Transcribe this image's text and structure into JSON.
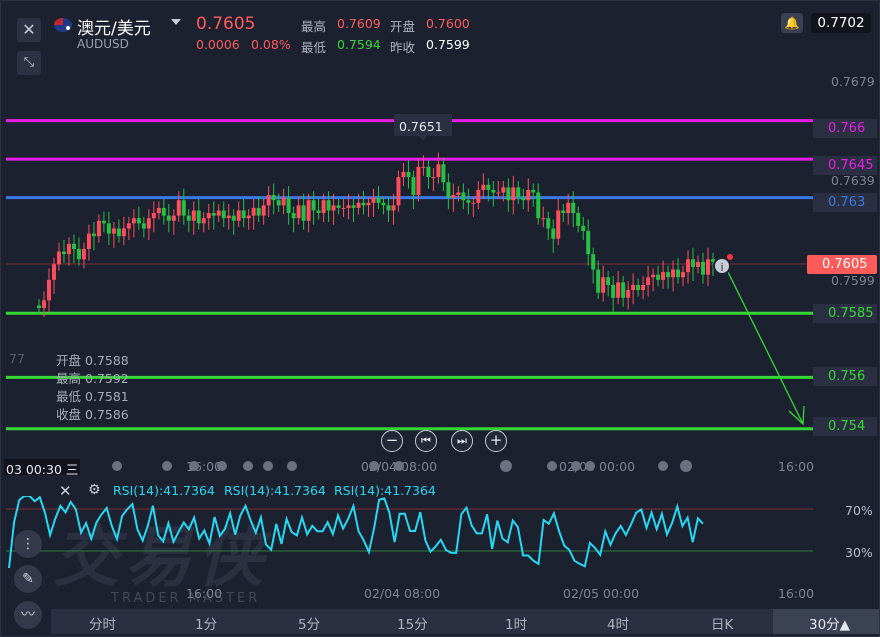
{
  "header": {
    "title": "澳元/美元",
    "code": "AUDUSD",
    "price": "0.7605",
    "change": "0.0006",
    "change_pct": "0.08%",
    "high_label": "最高",
    "high": "0.7609",
    "open_label": "开盘",
    "open": "0.7600",
    "low_label": "最低",
    "low": "0.7594",
    "prev_label": "昨收",
    "prev": "0.7599",
    "alert_price": "0.7702"
  },
  "icons": {
    "close": "close-icon",
    "collapse": "collapse-icon",
    "flag": "flag-icon",
    "bell": "bell-icon",
    "settings": "gear-icon",
    "crosshair": "crosshair-icon",
    "draw": "pencil-icon",
    "indicator": "chart-icon"
  },
  "levels": [
    {
      "label": "0.766",
      "value": 0.766,
      "color": "#e81ee8"
    },
    {
      "label": "0.7645",
      "value": 0.7645,
      "color": "#e81ee8"
    },
    {
      "label": "0.763",
      "value": 0.763,
      "color": "#3a78e8"
    },
    {
      "label": "0.7585",
      "value": 0.7585,
      "color": "#36d636"
    },
    {
      "label": "0.756",
      "value": 0.756,
      "color": "#36d636"
    },
    {
      "label": "0.754",
      "value": 0.754,
      "color": "#36d636"
    }
  ],
  "price_axis": [
    "0.7679",
    "0.7639",
    "0.7599"
  ],
  "current_tag": "0.7605",
  "peak_label": "0.7651",
  "ohlc_box": {
    "open_label": "开盘",
    "open": "0.7588",
    "high_label": "最高",
    "high": "0.7592",
    "low_label": "最低",
    "low": "0.7581",
    "close_label": "收盘",
    "close": "0.7586"
  },
  "time_axis": {
    "cursor": "03 00:30 三",
    "left_fragment": "77",
    "labels": [
      "16:00",
      "02/04 08:00",
      "02/05 00:00",
      "16:00"
    ]
  },
  "rsi": {
    "labels": [
      "RSI(14):41.7364",
      "RSI(14):41.7364",
      "RSI(14):41.7364"
    ],
    "upper": "70%",
    "lower": "30%",
    "color": "#27d7f2",
    "time_labels": [
      "16:00",
      "02/04 08:00",
      "02/05 00:00",
      "16:00"
    ]
  },
  "watermark": {
    "main": "交易侠",
    "sub": "TRADER MASTER"
  },
  "timeframes": [
    "分时",
    "1分",
    "5分",
    "15分",
    "1时",
    "4时",
    "日K",
    "30分▲"
  ],
  "chart_data": {
    "type": "candlestick",
    "symbol": "AUDUSD",
    "ylim": [
      0.7529,
      0.7691
    ],
    "open": [
      0.7588,
      0.7587,
      0.759,
      0.7598,
      0.7604,
      0.7609,
      0.7608,
      0.7612,
      0.761,
      0.7606,
      0.761,
      0.7616,
      0.7615,
      0.7621,
      0.762,
      0.7616,
      0.7618,
      0.7615,
      0.7618,
      0.762,
      0.7622,
      0.762,
      0.7618,
      0.7622,
      0.7624,
      0.7626,
      0.7623,
      0.7621,
      0.7623,
      0.7629,
      0.7623,
      0.7621,
      0.7625,
      0.762,
      0.7622,
      0.7624,
      0.7623,
      0.7625,
      0.7622,
      0.7623,
      0.7621,
      0.7625,
      0.7622,
      0.7623,
      0.7626,
      0.7623,
      0.7627,
      0.7631,
      0.7629,
      0.7627,
      0.763,
      0.7624,
      0.7622,
      0.7627,
      0.7621,
      0.7629,
      0.7625,
      0.7624,
      0.7629,
      0.7625,
      0.7627,
      0.7626,
      0.7626,
      0.7627,
      0.7626,
      0.7628,
      0.7627,
      0.7628,
      0.763,
      0.7628,
      0.7627,
      0.7625,
      0.7627,
      0.7638,
      0.764,
      0.7638,
      0.7631,
      0.7642,
      0.7642,
      0.7638,
      0.7638,
      0.7643,
      0.7636,
      0.763,
      0.7631,
      0.7632,
      0.7629,
      0.7628,
      0.7628,
      0.7633,
      0.7635,
      0.7633,
      0.7632,
      0.7632,
      0.7634,
      0.7629,
      0.7634,
      0.763,
      0.7629,
      0.7633,
      0.7632,
      0.7622,
      0.7622,
      0.7618,
      0.7614,
      0.7625,
      0.7624,
      0.7628,
      0.7624,
      0.7619,
      0.7617,
      0.7608,
      0.7602,
      0.7593,
      0.7599,
      0.7596,
      0.7591,
      0.7597,
      0.7591,
      0.7594,
      0.7596,
      0.7594,
      0.7596,
      0.7599,
      0.76,
      0.7598,
      0.7601,
      0.7599,
      0.7602,
      0.7599,
      0.7601,
      0.7606,
      0.7603,
      0.7605,
      0.76,
      0.7606
    ],
    "close": [
      0.7587,
      0.759,
      0.7598,
      0.7604,
      0.7609,
      0.7608,
      0.7612,
      0.761,
      0.7606,
      0.761,
      0.7616,
      0.7615,
      0.7621,
      0.762,
      0.7616,
      0.7618,
      0.7615,
      0.7618,
      0.762,
      0.7622,
      0.762,
      0.7618,
      0.7622,
      0.7624,
      0.7626,
      0.7623,
      0.7621,
      0.7623,
      0.7629,
      0.7623,
      0.7621,
      0.7625,
      0.762,
      0.7622,
      0.7624,
      0.7623,
      0.7625,
      0.7622,
      0.7623,
      0.7621,
      0.7625,
      0.7622,
      0.7623,
      0.7626,
      0.7623,
      0.7627,
      0.7631,
      0.7629,
      0.7627,
      0.763,
      0.7624,
      0.7622,
      0.7627,
      0.7621,
      0.7629,
      0.7625,
      0.7624,
      0.7629,
      0.7625,
      0.7627,
      0.7626,
      0.7626,
      0.7627,
      0.7626,
      0.7628,
      0.7627,
      0.7628,
      0.763,
      0.7628,
      0.7627,
      0.7625,
      0.7627,
      0.7638,
      0.764,
      0.7638,
      0.7631,
      0.7642,
      0.7642,
      0.7638,
      0.7638,
      0.7643,
      0.7636,
      0.763,
      0.7631,
      0.7632,
      0.7629,
      0.7628,
      0.7628,
      0.7633,
      0.7635,
      0.7633,
      0.7632,
      0.7632,
      0.7634,
      0.7629,
      0.7634,
      0.763,
      0.7629,
      0.7633,
      0.7632,
      0.7622,
      0.7622,
      0.7618,
      0.7614,
      0.7625,
      0.7624,
      0.7628,
      0.7624,
      0.7619,
      0.7617,
      0.7608,
      0.7602,
      0.7593,
      0.7599,
      0.7596,
      0.7591,
      0.7597,
      0.7591,
      0.7594,
      0.7596,
      0.7594,
      0.7596,
      0.7599,
      0.76,
      0.7598,
      0.7601,
      0.7599,
      0.7602,
      0.7599,
      0.7601,
      0.7606,
      0.7603,
      0.7605,
      0.76,
      0.7606,
      0.7605
    ]
  }
}
